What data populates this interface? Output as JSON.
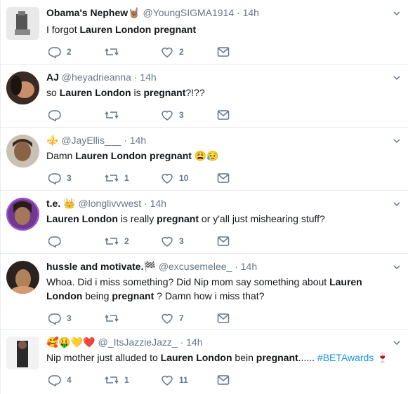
{
  "tweets": [
    {
      "name": "Obama's Nephew",
      "name_emoji": "🤘🏽",
      "handle": "@YoungSIGMA1914",
      "time": "14h",
      "text_parts": [
        {
          "t": "I forgot ",
          "b": false
        },
        {
          "t": "Lauren London",
          "b": true
        },
        {
          "t": " ",
          "b": false
        },
        {
          "t": "pregnant",
          "b": true
        }
      ],
      "replies": "2",
      "retweets": "",
      "likes": "2"
    },
    {
      "name": "AJ",
      "name_emoji": "",
      "handle": "@heyadrieanna",
      "time": "14h",
      "text_parts": [
        {
          "t": "so ",
          "b": false
        },
        {
          "t": "Lauren London",
          "b": true
        },
        {
          "t": " is ",
          "b": false
        },
        {
          "t": "pregnant",
          "b": true
        },
        {
          "t": "?!??",
          "b": false
        }
      ],
      "replies": "",
      "retweets": "",
      "likes": "3"
    },
    {
      "name": "⚜️",
      "name_emoji": "",
      "handle": "@JayEllis___",
      "time": "14h",
      "text_parts": [
        {
          "t": "Damn ",
          "b": false
        },
        {
          "t": "Lauren London",
          "b": true
        },
        {
          "t": " ",
          "b": false
        },
        {
          "t": "pregnant",
          "b": true
        },
        {
          "t": " 😩😥",
          "b": false
        }
      ],
      "replies": "3",
      "retweets": "1",
      "likes": "10"
    },
    {
      "name": "t.e.",
      "name_emoji": "👑",
      "handle": "@longlivvwest",
      "time": "14h",
      "text_parts": [
        {
          "t": "Lauren London",
          "b": true
        },
        {
          "t": " is really ",
          "b": false
        },
        {
          "t": "pregnant",
          "b": true
        },
        {
          "t": " or y'all just mishearing stuff?",
          "b": false
        }
      ],
      "replies": "",
      "retweets": "2",
      "likes": "3"
    },
    {
      "name": "hussle and motivate.",
      "name_emoji": "🏁",
      "handle": "@excusemelee_",
      "time": "14h",
      "text_parts": [
        {
          "t": "Whoa. Did i miss something? Did Nip mom say something about ",
          "b": false
        },
        {
          "t": "Lauren London",
          "b": true
        },
        {
          "t": " being ",
          "b": false
        },
        {
          "t": "pregnant",
          "b": true
        },
        {
          "t": " ? Damn how i miss that?",
          "b": false
        }
      ],
      "replies": "3",
      "retweets": "",
      "likes": "7"
    },
    {
      "name": "🥰🤑💛❤️",
      "name_emoji": "",
      "handle": "@_ItsJazzieJazz_",
      "time": "14h",
      "text_parts": [
        {
          "t": "Nip mother just alluded to ",
          "b": false
        },
        {
          "t": "Lauren London",
          "b": true
        },
        {
          "t": " bein ",
          "b": false
        },
        {
          "t": "pregnant",
          "b": true
        },
        {
          "t": "...... ",
          "b": false
        },
        {
          "t": "#BETAwards",
          "b": false,
          "tag": true
        },
        {
          "t": " 🍷",
          "b": false
        }
      ],
      "replies": "4",
      "retweets": "1",
      "likes": "11"
    }
  ],
  "colors": {
    "text": "#14171a",
    "muted": "#657786",
    "link": "#1b95e0",
    "border": "#e6ecf0"
  }
}
